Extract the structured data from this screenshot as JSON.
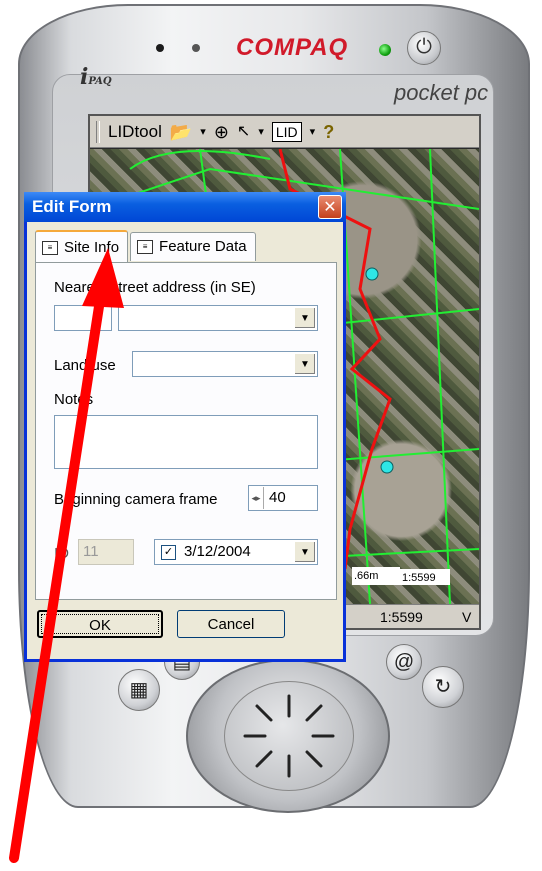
{
  "device": {
    "brand": "COMPAQ",
    "model_prefix": "i",
    "model_suffix": "PAQ",
    "product_line": "pocket pc",
    "power_glyph": "⏻"
  },
  "pocketpc": {
    "app_name": "LIDtool",
    "lid_button": "LID",
    "help_glyph": "?",
    "status_scale": "1:5599",
    "status_v": "V",
    "map_scale_label": "1:5599",
    "map_scale_dist": ".66m"
  },
  "dialog": {
    "title": "Edit Form",
    "tabs": [
      {
        "label": "Site Info",
        "active": true
      },
      {
        "label": "Feature Data",
        "active": false
      }
    ],
    "address_label": "Nearest street address (in SE)",
    "address_number": "",
    "address_street": "",
    "land_use_label": "Land use",
    "land_use_value": "",
    "notes_label": "Notes",
    "notes_value": "",
    "camera_label": "Beginning camera frame",
    "camera_value": "40",
    "id_label": "ID",
    "id_value": "11",
    "date_value": "3/12/2004",
    "date_checked": true,
    "ok_label": "OK",
    "cancel_label": "Cancel"
  },
  "colors": {
    "titlebar": "#0a5fe0",
    "arrow": "#ff0000",
    "brand": "#d11a2a"
  }
}
